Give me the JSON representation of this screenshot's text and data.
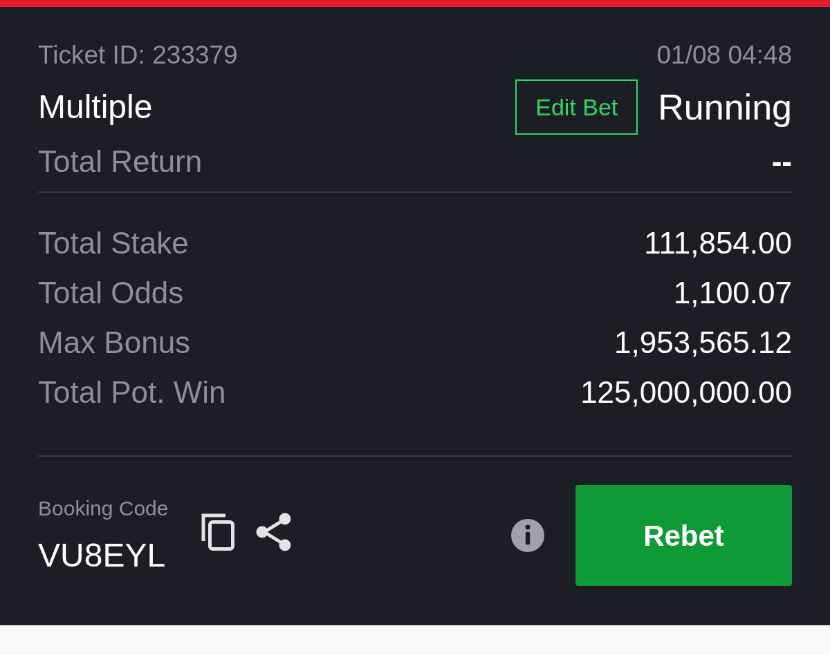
{
  "ticket": {
    "id_label": "Ticket ID: 233379",
    "datetime": "01/08 04:48",
    "type": "Multiple",
    "edit_button": "Edit Bet",
    "status": "Running",
    "return_label": "Total Return",
    "return_value": "--"
  },
  "summary": [
    {
      "label": "Total Stake",
      "value": "111,854.00"
    },
    {
      "label": "Total Odds",
      "value": "1,100.07"
    },
    {
      "label": "Max Bonus",
      "value": "1,953,565.12"
    },
    {
      "label": "Total Pot. Win",
      "value": "125,000,000.00"
    }
  ],
  "booking": {
    "label": "Booking Code",
    "code": "VU8EYL"
  },
  "rebet_button": "Rebet"
}
